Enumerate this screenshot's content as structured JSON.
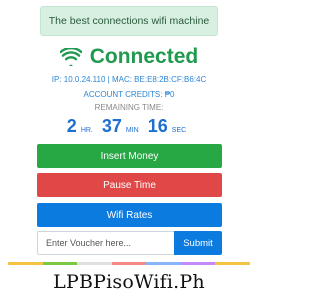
{
  "banner": {
    "text": "The best connections wifi machine"
  },
  "status": {
    "label": "Connected",
    "icon": "wifi-icon",
    "color": "#1f9a4f"
  },
  "info": {
    "ip_mac": "IP: 10.0.24.110 | MAC: BE:E8:2B:CF:B6:4C",
    "credits": "ACCOUNT CREDITS: ₱0",
    "remaining_label": "REMAINING TIME:"
  },
  "time": {
    "hours": "2",
    "hours_unit": "HR.",
    "minutes": "37",
    "minutes_unit": "MIN",
    "seconds": "16",
    "seconds_unit": "SEC"
  },
  "buttons": {
    "insert": "Insert Money",
    "pause": "Pause Time",
    "rates": "Wifi Rates"
  },
  "voucher": {
    "placeholder": "Enter Voucher here...",
    "submit": "Submit"
  },
  "footer": {
    "text": "LPBPisoWifi.Ph"
  },
  "colors": {
    "green": "#28a745",
    "red": "#e04848",
    "blue": "#0b7be0",
    "stripe": [
      "#f4c542",
      "#7ac943",
      "#e0e0e0",
      "#f28b82",
      "#8ab4f8",
      "#c58af9",
      "#f4c542"
    ]
  }
}
